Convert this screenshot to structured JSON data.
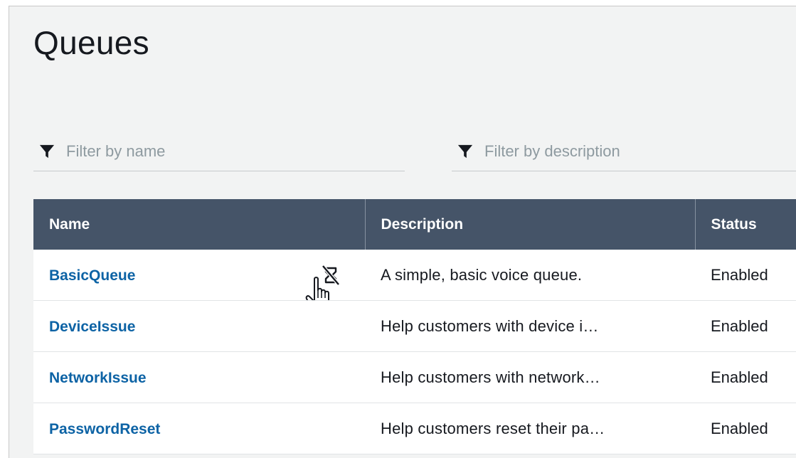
{
  "page": {
    "title": "Queues"
  },
  "filters": {
    "name_placeholder": "Filter by name",
    "description_placeholder": "Filter by description",
    "icon": "filter-icon"
  },
  "table": {
    "headers": {
      "name": "Name",
      "description": "Description",
      "status": "Status"
    },
    "rows": [
      {
        "name": "BasicQueue",
        "description": "A simple, basic voice queue.",
        "status": "Enabled"
      },
      {
        "name": "DeviceIssue",
        "description": "Help customers with device i…",
        "status": "Enabled"
      },
      {
        "name": "NetworkIssue",
        "description": "Help customers with network…",
        "status": "Enabled"
      },
      {
        "name": "PasswordReset",
        "description": "Help customers reset their pa…",
        "status": "Enabled"
      }
    ]
  },
  "hover": {
    "row_icon": "disable-icon",
    "cursor": "hand-cursor-icon"
  },
  "colors": {
    "header_bg": "#455468",
    "link": "#0d63a5",
    "background": "#f2f3f3"
  }
}
